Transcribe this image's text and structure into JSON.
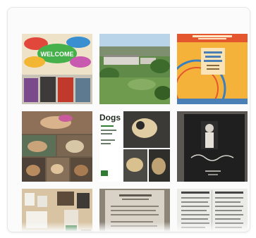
{
  "gallery": {
    "tiles": [
      {
        "id": 1,
        "icon": "welcome-sign-photo",
        "text": "WELCOME"
      },
      {
        "id": 2,
        "icon": "campus-aerial-photo"
      },
      {
        "id": 3,
        "icon": "ferris-wheel-poster"
      },
      {
        "id": 4,
        "icon": "dogs-collage-photo"
      },
      {
        "id": 5,
        "icon": "dogs-flyer-photo",
        "text": "Dogs"
      },
      {
        "id": 6,
        "icon": "book-cover-photo"
      },
      {
        "id": 7,
        "icon": "library-room-photo"
      },
      {
        "id": 8,
        "icon": "document-photo"
      },
      {
        "id": 9,
        "icon": "table-printout-photo"
      }
    ]
  },
  "colors": {
    "frame_bg": "#fbfbfb",
    "frame_border": "#e7e7e7"
  }
}
